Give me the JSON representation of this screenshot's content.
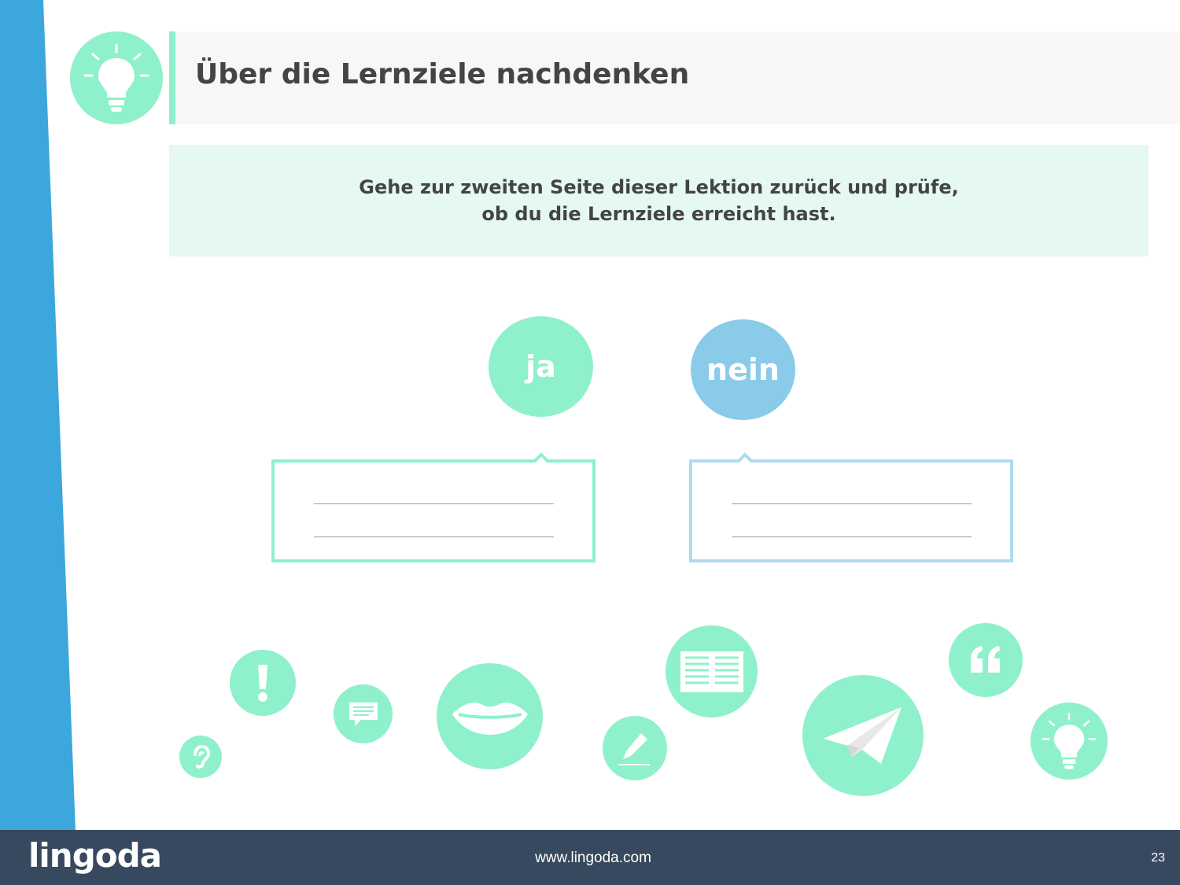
{
  "header": {
    "title": "Über die Lernziele nachdenken",
    "icon": "lightbulb-icon"
  },
  "instruction": {
    "line1": "Gehe zur zweiten Seite dieser Lektion zurück und prüfe,",
    "line2": "ob du die Lernziele erreicht hast."
  },
  "answers": {
    "yes_label": "ja",
    "no_label": "nein"
  },
  "decorative_icons": [
    "ear-icon",
    "exclamation-icon",
    "chat-bubble-icon",
    "lips-icon",
    "pencil-icon",
    "newspaper-icon",
    "paper-plane-icon",
    "quote-icon",
    "lightbulb-icon"
  ],
  "colors": {
    "accent_green": "#8ef1cb",
    "accent_blue": "#89cbe9",
    "stripe_blue": "#3ba7dd",
    "footer_bg": "#37495e",
    "instruction_bg": "#e5f9f0"
  },
  "footer": {
    "logo": "lingoda",
    "url": "www.lingoda.com",
    "page_number": "23"
  }
}
